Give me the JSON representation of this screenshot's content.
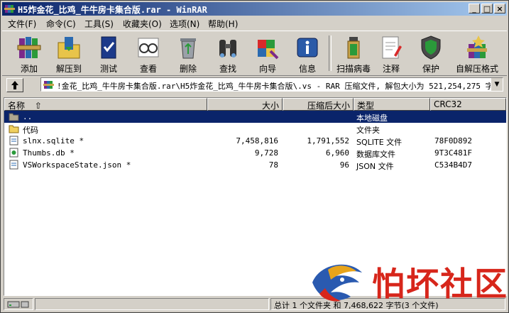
{
  "window": {
    "title": "H5炸金花_比鸡_牛牛房卡集合版.rar - WinRAR"
  },
  "menu": [
    "文件(F)",
    "命令(C)",
    "工具(S)",
    "收藏夹(O)",
    "选项(N)",
    "帮助(H)"
  ],
  "toolbar": [
    {
      "label": "添加",
      "icon": "books-icon"
    },
    {
      "label": "解压到",
      "icon": "folder-extract-icon"
    },
    {
      "label": "测试",
      "icon": "test-book-icon"
    },
    {
      "label": "查看",
      "icon": "glasses-icon"
    },
    {
      "label": "删除",
      "icon": "recycle-icon"
    },
    {
      "label": "查找",
      "icon": "binoculars-icon"
    },
    {
      "label": "向导",
      "icon": "wizard-icon"
    },
    {
      "label": "信息",
      "icon": "info-icon"
    },
    {
      "label": "扫描病毒",
      "icon": "virus-scan-icon"
    },
    {
      "label": "注释",
      "icon": "comment-icon"
    },
    {
      "label": "保护",
      "icon": "shield-icon"
    },
    {
      "label": "自解压格式",
      "icon": "sfx-icon"
    }
  ],
  "address": {
    "text": "!金花_比鸡_牛牛房卡集合版.rar\\H5炸金花_比鸡_牛牛房卡集合版\\.vs - RAR 压缩文件, 解包大小为 521,254,275 字节"
  },
  "columns": {
    "name": "名称",
    "size": "大小",
    "packed": "压缩后大小",
    "type": "类型",
    "crc": "CRC32"
  },
  "rows": [
    {
      "name": "..",
      "size": "",
      "packed": "",
      "type": "本地磁盘",
      "crc": "",
      "icon": "parent-folder-icon"
    },
    {
      "name": "代码",
      "size": "",
      "packed": "",
      "type": "文件夹",
      "crc": "",
      "icon": "folder-icon"
    },
    {
      "name": "slnx.sqlite *",
      "size": "7,458,816",
      "packed": "1,791,552",
      "type": "SQLITE 文件",
      "crc": "78F0D892",
      "icon": "file-icon"
    },
    {
      "name": "Thumbs.db *",
      "size": "9,728",
      "packed": "6,960",
      "type": "数据库文件",
      "crc": "9T3C481F",
      "icon": "db-file-icon"
    },
    {
      "name": "VSWorkspaceState.json *",
      "size": "78",
      "packed": "96",
      "type": "JSON 文件",
      "crc": "C534B4D7",
      "icon": "file-icon"
    }
  ],
  "status": {
    "summary": "总计 1 个文件夹 和 7,468,622 字节(3 个文件)"
  },
  "watermark": {
    "text": "怕坏社区"
  },
  "colors": {
    "titlebar": "#0a246a",
    "selection": "#0a246a",
    "watermark": "#d7261b"
  }
}
